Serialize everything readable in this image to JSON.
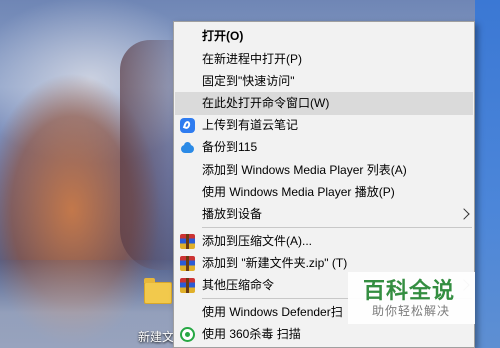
{
  "desktop": {
    "folder_label": "新建文"
  },
  "context_menu": {
    "items": [
      {
        "label": "打开(O)",
        "icon": null,
        "bold": true
      },
      {
        "label": "在新进程中打开(P)",
        "icon": null
      },
      {
        "label": "固定到\"快速访问\"",
        "icon": null
      },
      {
        "label": "在此处打开命令窗口(W)",
        "icon": null,
        "highlighted": true
      },
      {
        "label": "上传到有道云笔记",
        "icon": "youdao-note-icon"
      },
      {
        "label": "备份到115",
        "icon": "cloud-115-icon"
      },
      {
        "label": "添加到 Windows Media Player 列表(A)",
        "icon": null
      },
      {
        "label": "使用 Windows Media Player 播放(P)",
        "icon": null
      },
      {
        "label": "播放到设备",
        "icon": null,
        "submenu": true
      },
      {
        "label": "添加到压缩文件(A)...",
        "icon": "winrar-icon"
      },
      {
        "label": "添加到 \"新建文件夹.zip\" (T)",
        "icon": "winrar-icon"
      },
      {
        "label": "其他压缩命令",
        "icon": "winrar-icon",
        "submenu": true
      },
      {
        "label": "使用 Windows Defender扫",
        "icon": null
      },
      {
        "label": "使用 360杀毒 扫描",
        "icon": "360-antivirus-icon"
      }
    ]
  },
  "watermark": {
    "title": "百科全说",
    "subtitle": "助你轻松解决"
  },
  "colors": {
    "menu_bg": "#f2f2f2",
    "highlight": "#dadada",
    "watermark_green": "#2d8a3a"
  }
}
